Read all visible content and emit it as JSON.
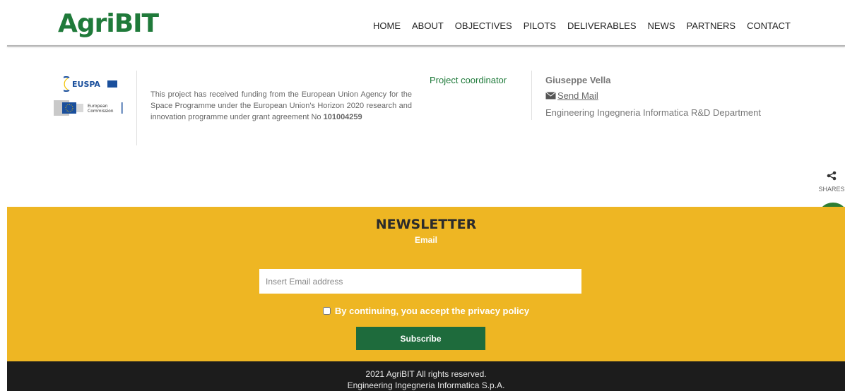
{
  "header": {
    "logo_text": "AgriBIT",
    "nav": [
      "HOME",
      "ABOUT",
      "OBJECTIVES",
      "PILOTS",
      "DELIVERABLES",
      "NEWS",
      "PARTNERS",
      "CONTACT"
    ]
  },
  "partners": {
    "euspa_text": "EUSPA",
    "ec_text_1": "European",
    "ec_text_2": "Commission"
  },
  "funding": {
    "text": "This project has received funding from the European Union Agency for the Space Programme under the European Union's Horizon 2020 research and innovation programme under grant agreement No",
    "grant_no": "101004259"
  },
  "coordinator": {
    "label": "Project coordinator",
    "name": "Giuseppe Vella",
    "mail_label": "Send Mail",
    "org": "Engineering Ingegneria Informatica R&D Department"
  },
  "share": {
    "label": "SHARES"
  },
  "newsletter": {
    "title": "NEWSLETTER",
    "email_label": "Email",
    "email_placeholder": "Insert Email address",
    "email_value": "",
    "consent_label": "By continuing, you accept the privacy policy",
    "subscribe_label": "Subscribe"
  },
  "footer": {
    "line1": "2021 AgriBIT All rights reserved.",
    "line2": "Engineering Ingegneria Informatica S.p.A."
  },
  "colors": {
    "brand_green": "#1f7a3a",
    "newsletter_bg": "#eeb623",
    "subscribe_bg": "#1e6b3c",
    "footer_bg": "#1c1c1c"
  }
}
